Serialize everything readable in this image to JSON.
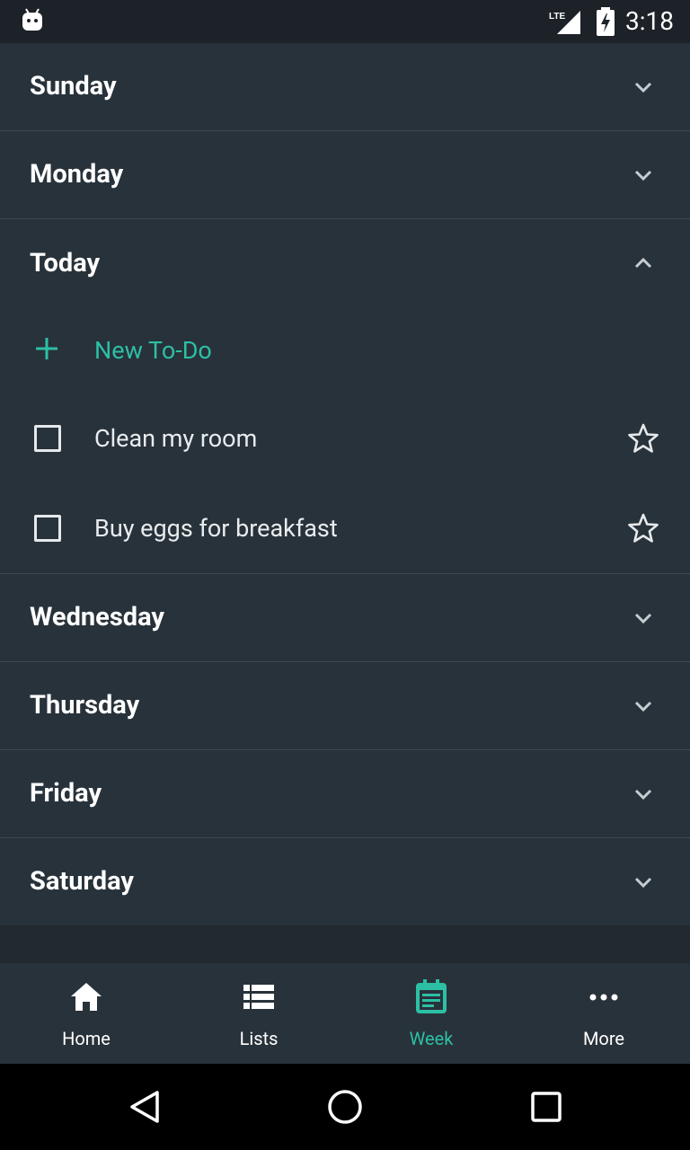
{
  "status_bar": {
    "time": "3:18",
    "network": "LTE"
  },
  "days": [
    {
      "label": "Sunday"
    },
    {
      "label": "Monday"
    }
  ],
  "today": {
    "label": "Today",
    "new_todo_label": "New To-Do",
    "items": [
      {
        "text": "Clean my room"
      },
      {
        "text": "Buy eggs for breakfast"
      }
    ]
  },
  "later_days": [
    {
      "label": "Wednesday"
    },
    {
      "label": "Thursday"
    },
    {
      "label": "Friday"
    },
    {
      "label": "Saturday"
    }
  ],
  "bottom_nav": {
    "items": [
      {
        "label": "Home",
        "icon": "home-icon"
      },
      {
        "label": "Lists",
        "icon": "list-icon"
      },
      {
        "label": "Week",
        "icon": "calendar-icon",
        "active": true
      },
      {
        "label": "More",
        "icon": "more-icon"
      }
    ]
  },
  "colors": {
    "accent": "#2dbfa5",
    "background": "#28323a",
    "status_bar": "#1c2227"
  }
}
